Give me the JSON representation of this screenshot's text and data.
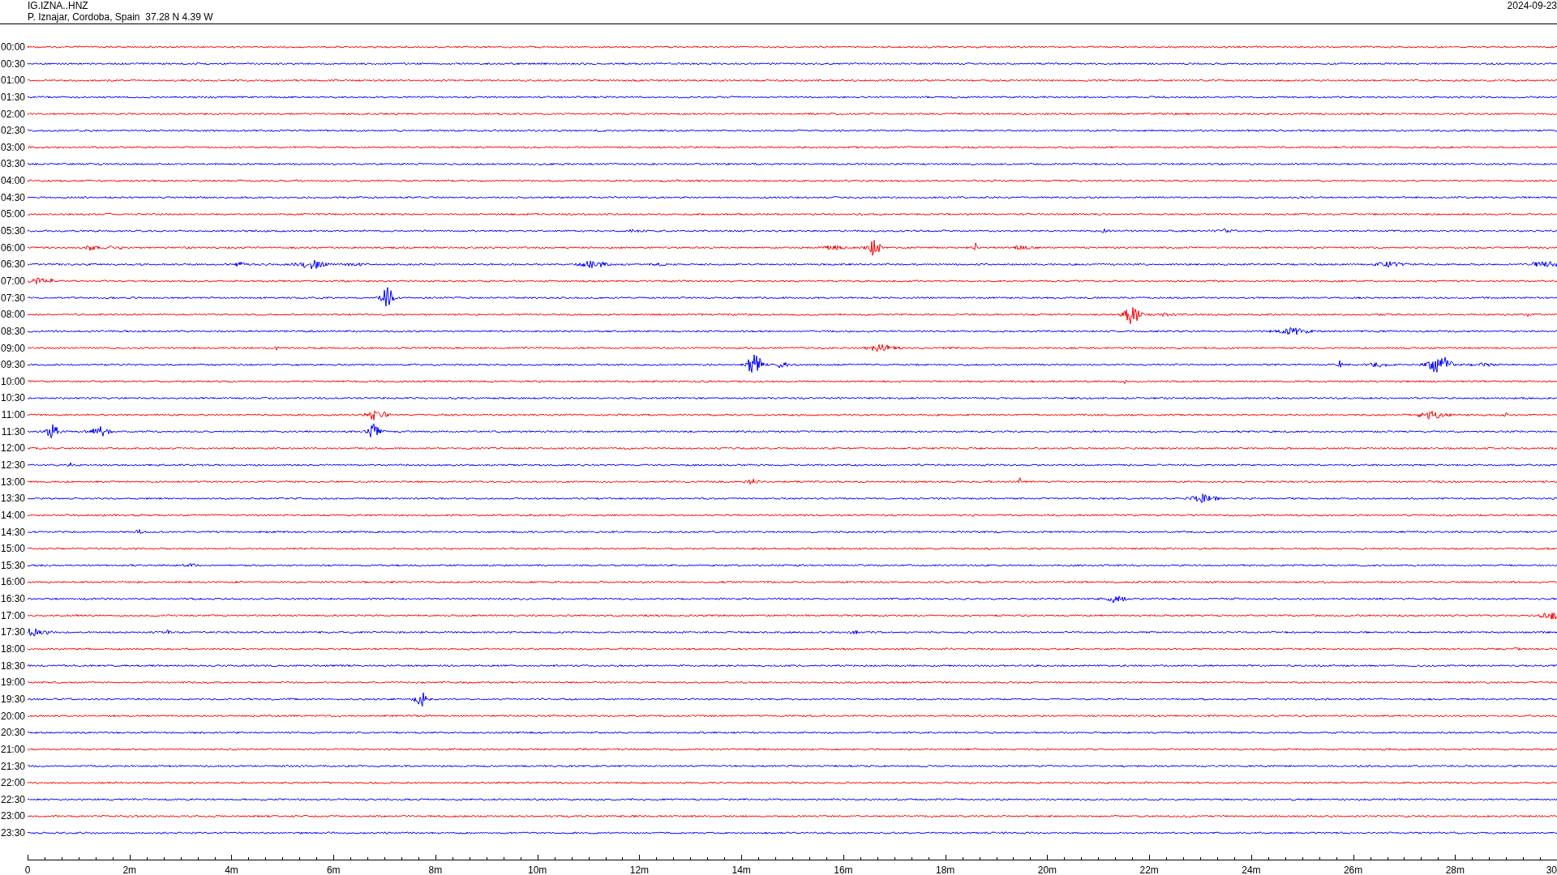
{
  "header": {
    "station": "IG.IZNA..HNZ",
    "location": "P. Iznajar, Cordoba, Spain  37.28 N 4.39 W",
    "date": "2024-09-23"
  },
  "plot": {
    "rows": [
      {
        "label": "00:00",
        "color": "#ff0000"
      },
      {
        "label": "00:30",
        "color": "#0000ff"
      },
      {
        "label": "01:00",
        "color": "#ff0000"
      },
      {
        "label": "01:30",
        "color": "#0000ff"
      },
      {
        "label": "02:00",
        "color": "#ff0000"
      },
      {
        "label": "02:30",
        "color": "#0000ff"
      },
      {
        "label": "03:00",
        "color": "#ff0000"
      },
      {
        "label": "03:30",
        "color": "#0000ff"
      },
      {
        "label": "04:00",
        "color": "#ff0000"
      },
      {
        "label": "04:30",
        "color": "#0000ff"
      },
      {
        "label": "05:00",
        "color": "#ff0000"
      },
      {
        "label": "05:30",
        "color": "#0000ff"
      },
      {
        "label": "06:00",
        "color": "#ff0000"
      },
      {
        "label": "06:30",
        "color": "#0000ff"
      },
      {
        "label": "07:00",
        "color": "#ff0000"
      },
      {
        "label": "07:30",
        "color": "#0000ff"
      },
      {
        "label": "08:00",
        "color": "#ff0000"
      },
      {
        "label": "08:30",
        "color": "#0000ff"
      },
      {
        "label": "09:00",
        "color": "#ff0000"
      },
      {
        "label": "09:30",
        "color": "#0000ff"
      },
      {
        "label": "10:00",
        "color": "#ff0000"
      },
      {
        "label": "10:30",
        "color": "#0000ff"
      },
      {
        "label": "11:00",
        "color": "#ff0000"
      },
      {
        "label": "11:30",
        "color": "#0000ff"
      },
      {
        "label": "12:00",
        "color": "#ff0000"
      },
      {
        "label": "12:30",
        "color": "#0000ff"
      },
      {
        "label": "13:00",
        "color": "#ff0000"
      },
      {
        "label": "13:30",
        "color": "#0000ff"
      },
      {
        "label": "14:00",
        "color": "#ff0000"
      },
      {
        "label": "14:30",
        "color": "#0000ff"
      },
      {
        "label": "15:00",
        "color": "#ff0000"
      },
      {
        "label": "15:30",
        "color": "#0000ff"
      },
      {
        "label": "16:00",
        "color": "#ff0000"
      },
      {
        "label": "16:30",
        "color": "#0000ff"
      },
      {
        "label": "17:00",
        "color": "#ff0000"
      },
      {
        "label": "17:30",
        "color": "#0000ff"
      },
      {
        "label": "18:00",
        "color": "#ff0000"
      },
      {
        "label": "18:30",
        "color": "#0000ff"
      },
      {
        "label": "19:00",
        "color": "#ff0000"
      },
      {
        "label": "19:30",
        "color": "#0000ff"
      },
      {
        "label": "20:00",
        "color": "#ff0000"
      },
      {
        "label": "20:30",
        "color": "#0000ff"
      },
      {
        "label": "21:00",
        "color": "#ff0000"
      },
      {
        "label": "21:30",
        "color": "#0000ff"
      },
      {
        "label": "22:00",
        "color": "#ff0000"
      },
      {
        "label": "22:30",
        "color": "#0000ff"
      },
      {
        "label": "23:00",
        "color": "#ff0000"
      },
      {
        "label": "23:30",
        "color": "#0000ff"
      }
    ],
    "x_axis": {
      "ticks": [
        "0",
        "2m",
        "4m",
        "6m",
        "8m",
        "10m",
        "12m",
        "14m",
        "16m",
        "18m",
        "20m",
        "22m",
        "24m",
        "26m",
        "28m",
        "30"
      ]
    }
  }
}
